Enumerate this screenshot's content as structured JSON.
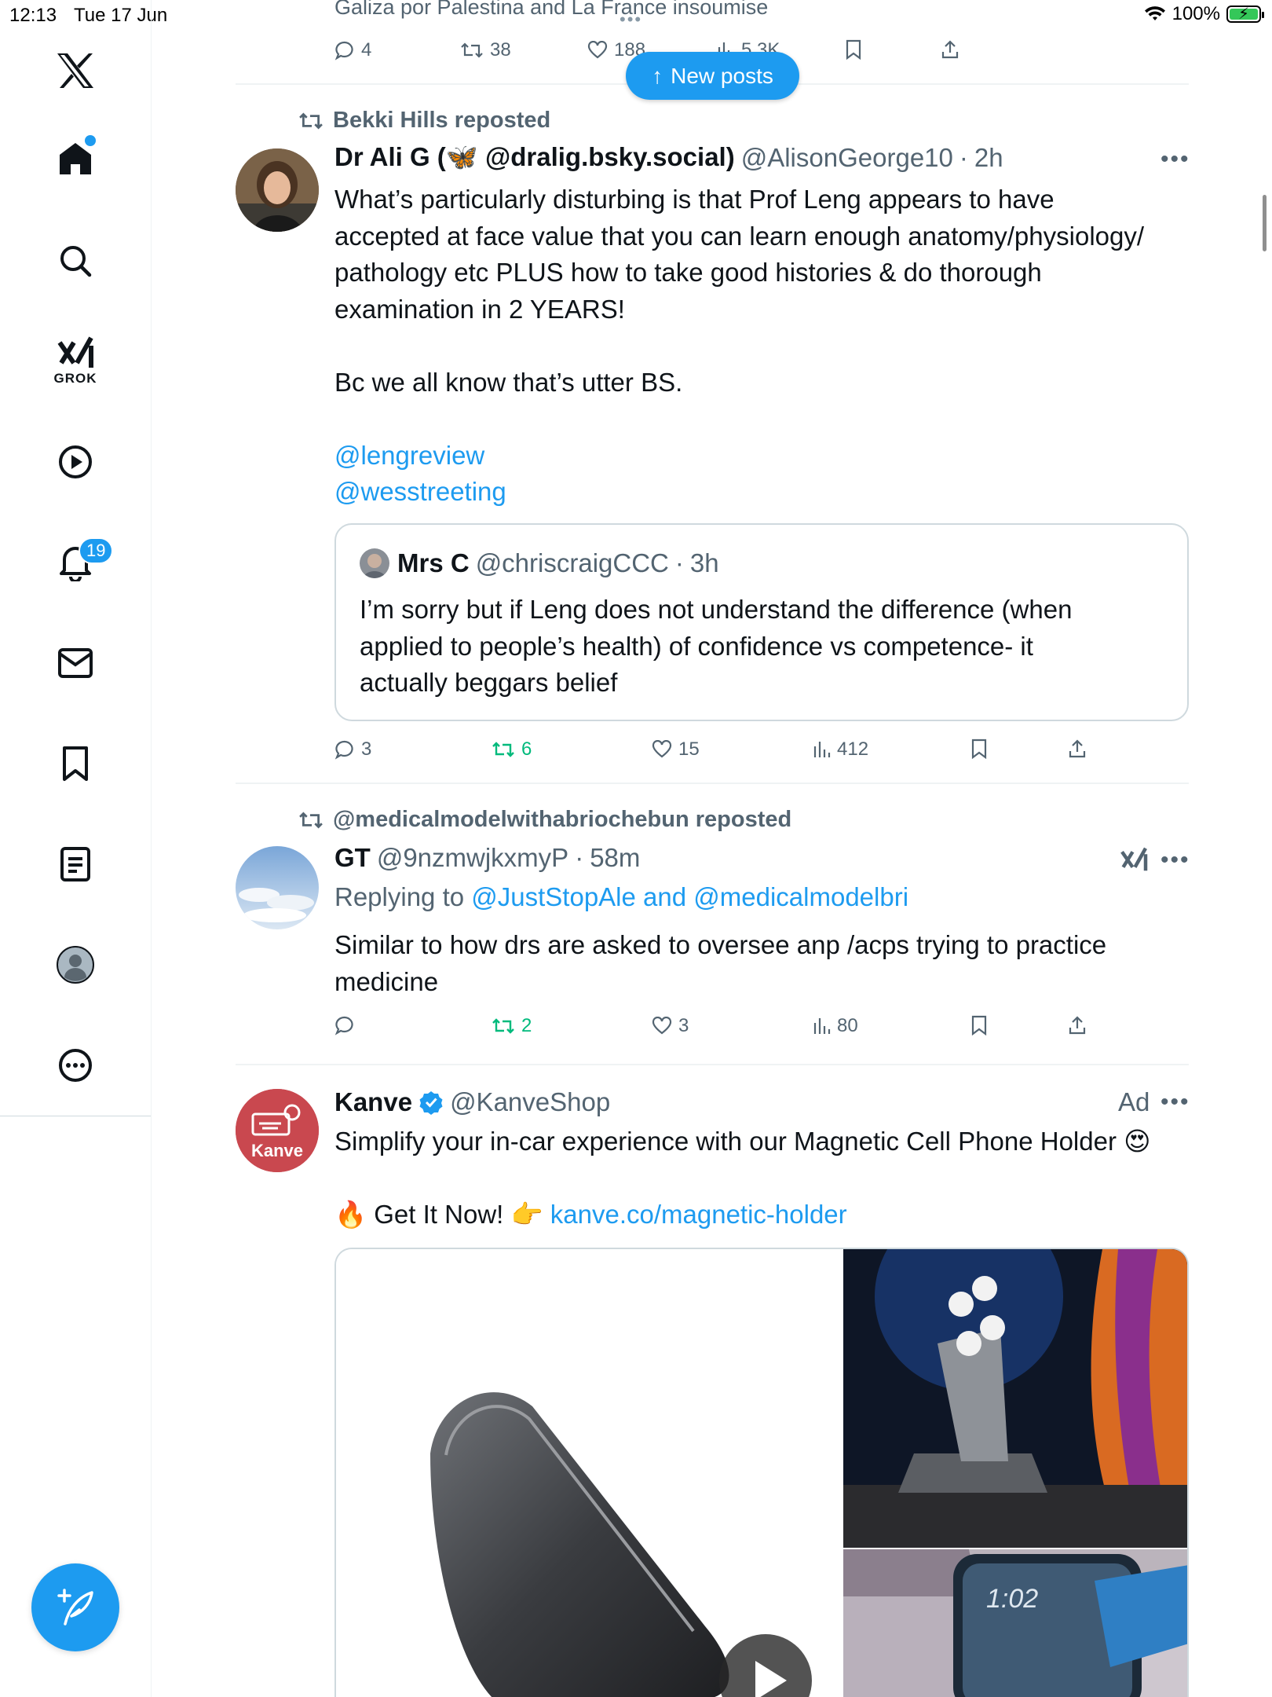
{
  "status_bar": {
    "time": "12:13",
    "date": "Tue 17 Jun",
    "battery_text": "100%",
    "battery_level": 1.0
  },
  "sidebar": {
    "items": [
      {
        "name": "home",
        "icon": "home-icon",
        "active": true
      },
      {
        "name": "explore",
        "icon": "search-icon"
      },
      {
        "name": "grok",
        "icon": "grok-icon",
        "label": "GROK"
      },
      {
        "name": "videos",
        "icon": "play-circle-icon"
      },
      {
        "name": "notifications",
        "icon": "bell-icon",
        "badge": "19"
      },
      {
        "name": "messages",
        "icon": "mail-icon"
      },
      {
        "name": "bookmarks",
        "icon": "bookmark-icon"
      },
      {
        "name": "lists",
        "icon": "list-icon"
      },
      {
        "name": "profile",
        "icon": "profile-avatar-icon"
      },
      {
        "name": "more",
        "icon": "more-circle-icon"
      }
    ],
    "compose": {
      "icon": "compose-icon"
    }
  },
  "colors": {
    "accent": "#1d9bf0",
    "repost_green": "#00ba7c",
    "muted": "#536471"
  },
  "new_posts": {
    "label": "New posts"
  },
  "previous_post": {
    "fragment": "Galiza por Palestina and La France insoumise",
    "actions": {
      "replies": "4",
      "reposts": "38",
      "likes": "188",
      "views": "5.3K"
    }
  },
  "posts": [
    {
      "repost_by": "Bekki Hills reposted",
      "display_name": "Dr Ali G (🦋 @dralig.bsky.social)",
      "handle": "@AlisonGeorge10",
      "time": "2h",
      "body_lines": [
        "What’s particularly disturbing is that Prof Leng appears to have",
        "accepted at face value that you can learn enough anatomy/physiology/",
        "pathology etc PLUS how to take good histories & do thorough",
        "examination in 2 YEARS!",
        "Bc we all know that’s utter BS."
      ],
      "mentions": [
        "@lengreview",
        "@wesstreeting"
      ],
      "quote": {
        "display_name": "Mrs C",
        "handle": "@chriscraigCCC",
        "time": "3h",
        "body_lines": [
          "I’m sorry but if Leng does not understand the difference (when",
          "applied to people’s health) of confidence vs competence- it",
          "actually beggars belief"
        ]
      },
      "actions": {
        "replies": "3",
        "reposts": "6",
        "likes": "15",
        "views": "412"
      }
    },
    {
      "repost_by": "@medicalmodelwithabriochebun reposted",
      "display_name": "GT",
      "handle": "@9nzmwjkxmyP",
      "time": "58m",
      "replying_prefix": "Replying to ",
      "replying_to": "@JustStopAle and @medicalmodelbri",
      "body_lines": [
        "Similar to how drs are asked to oversee anp /acps trying to practice",
        "medicine"
      ],
      "actions": {
        "replies": "",
        "reposts": "2",
        "likes": "3",
        "views": "80"
      }
    },
    {
      "display_name": "Kanve",
      "verified": true,
      "handle": "@KanveShop",
      "ad_label": "Ad",
      "avatar_text": "Kanve",
      "body_line1": "Simplify your in-car experience with our Magnetic Cell Phone Holder",
      "body_emoji1": "😍",
      "cta_emoji": "🔥",
      "cta_text": "Get It Now!",
      "cta_pointer": "👉",
      "cta_link": "kanve.co/magnetic-holder",
      "media_clock": "1:02"
    }
  ]
}
